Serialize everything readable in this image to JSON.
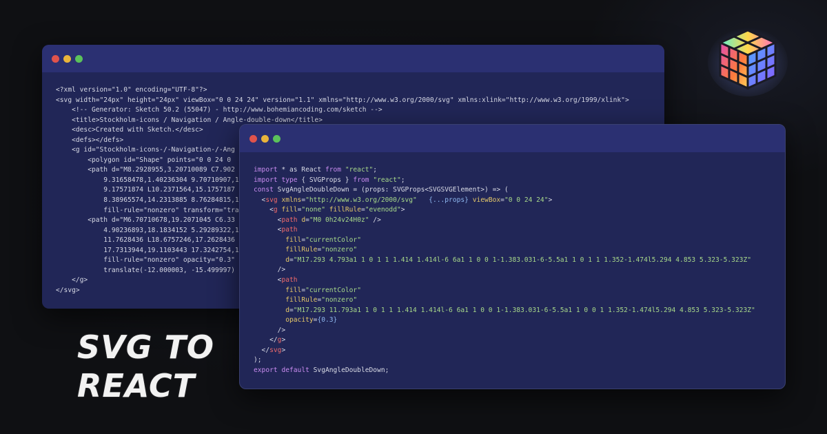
{
  "headline": {
    "line1": "SVG TO",
    "line2": "REACT"
  },
  "colors": {
    "background": "#0f1013",
    "window_bg": "#212657",
    "titlebar_bg": "#2b3072",
    "dot_red": "#e0534c",
    "dot_yellow": "#e9b43b",
    "dot_green": "#5bc25b"
  },
  "icons": {
    "logo": "colorful-cube-logo-icon",
    "window_dots": [
      "close-dot-icon",
      "minimize-dot-icon",
      "maximize-dot-icon"
    ]
  },
  "svg_window": {
    "lines": [
      "<?xml version=\"1.0\" encoding=\"UTF-8\"?>",
      "<svg width=\"24px\" height=\"24px\" viewBox=\"0 0 24 24\" version=\"1.1\" xmlns=\"http://www.w3.org/2000/svg\" xmlns:xlink=\"http://www.w3.org/1999/xlink\">",
      "    <!-- Generator: Sketch 50.2 (55047) - http://www.bohemiancoding.com/sketch -->",
      "    <title>Stockholm-icons / Navigation / Angle-double-down</title>",
      "    <desc>Created with Sketch.</desc>",
      "    <defs></defs>",
      "    <g id=\"Stockholm-icons-/-Navigation-/-Ang",
      "        <polygon id=\"Shape\" points=\"0 0 24 0",
      "        <path d=\"M8.2928955,3.20710089 C7.902",
      "            9.31658478,1.40236304 9.70710907,1.79",
      "            9.17571874 L10.2371564,15.1757187 C9.",
      "            8.38965574,14.2313885 8.76284815,13.8",
      "            fill-rule=\"nonzero\" transform=\"transl",
      "        <path d=\"M6.70710678,19.2071045 C6.33",
      "            4.90236893,18.1834152 5.29289322,17.7",
      "            11.7628436 L18.6757246,17.2628436 C19",
      "            17.7313944,19.1103443 17.3242754,18.7",
      "            fill-rule=\"nonzero\" opacity=\"0.3\" tra",
      "            translate(-12.000003, -15.499997) \">",
      "    </g>",
      "</svg>"
    ]
  },
  "react_window": {
    "lines": [
      "import * as React from \"react\";",
      "import type { SVGProps } from \"react\";",
      "const SvgAngleDoubleDown = (props: SVGProps<SVGSVGElement>) => (",
      "  <svg xmlns=\"http://www.w3.org/2000/svg\"   {...props} viewBox=\"0 0 24 24\">",
      "    <g fill=\"none\" fillRule=\"evenodd\">",
      "      <path d=\"M0 0h24v24H0z\" />",
      "      <path",
      "        fill=\"currentColor\"",
      "        fillRule=\"nonzero\"",
      "        d=\"M17.293 4.793a1 1 0 1 1 1.414 1.414l-6 6a1 1 0 0 1-1.383.031-6-5.5a1 1 0 1 1 1.352-1.474l5.294 4.853 5.323-5.323Z\"",
      "      />",
      "      <path",
      "        fill=\"currentColor\"",
      "        fillRule=\"nonzero\"",
      "        d=\"M17.293 11.793a1 1 0 1 1 1.414 1.414l-6 6a1 1 0 0 1-1.383.031-6-5.5a1 1 0 0 1 1.352-1.474l5.294 4.853 5.323-5.323Z\"",
      "        opacity={0.3}",
      "      />",
      "    </g>",
      "  </svg>",
      ");",
      "export default SvgAngleDoubleDown;"
    ]
  }
}
